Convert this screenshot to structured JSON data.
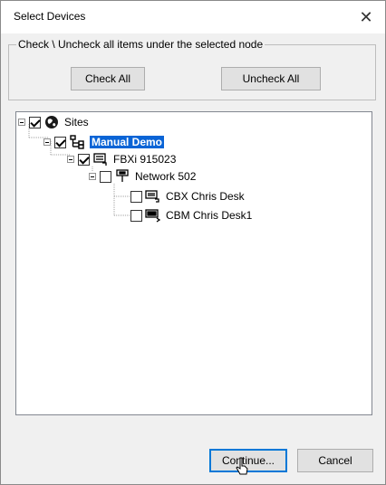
{
  "window": {
    "title": "Select Devices",
    "close_symbol": "✕"
  },
  "group": {
    "legend": "Check \\ Uncheck all items under the selected node",
    "check_all_label": "Check All",
    "uncheck_all_label": "Uncheck All"
  },
  "tree": {
    "nodes": [
      {
        "label": "Sites",
        "checked": true,
        "icon": "globe-icon"
      },
      {
        "label": "Manual Demo",
        "checked": true,
        "icon": "network-icon",
        "selected": true
      },
      {
        "label": "FBXi 915023",
        "checked": true,
        "icon": "device-icon"
      },
      {
        "label": "Network 502",
        "checked": false,
        "icon": "network-node-icon"
      },
      {
        "label": "CBX Chris Desk",
        "checked": false,
        "icon": "cbx-device-icon"
      },
      {
        "label": "CBM Chris Desk1",
        "checked": false,
        "icon": "cbm-device-icon"
      }
    ]
  },
  "footer": {
    "continue_label": "Continue...",
    "cancel_label": "Cancel"
  }
}
